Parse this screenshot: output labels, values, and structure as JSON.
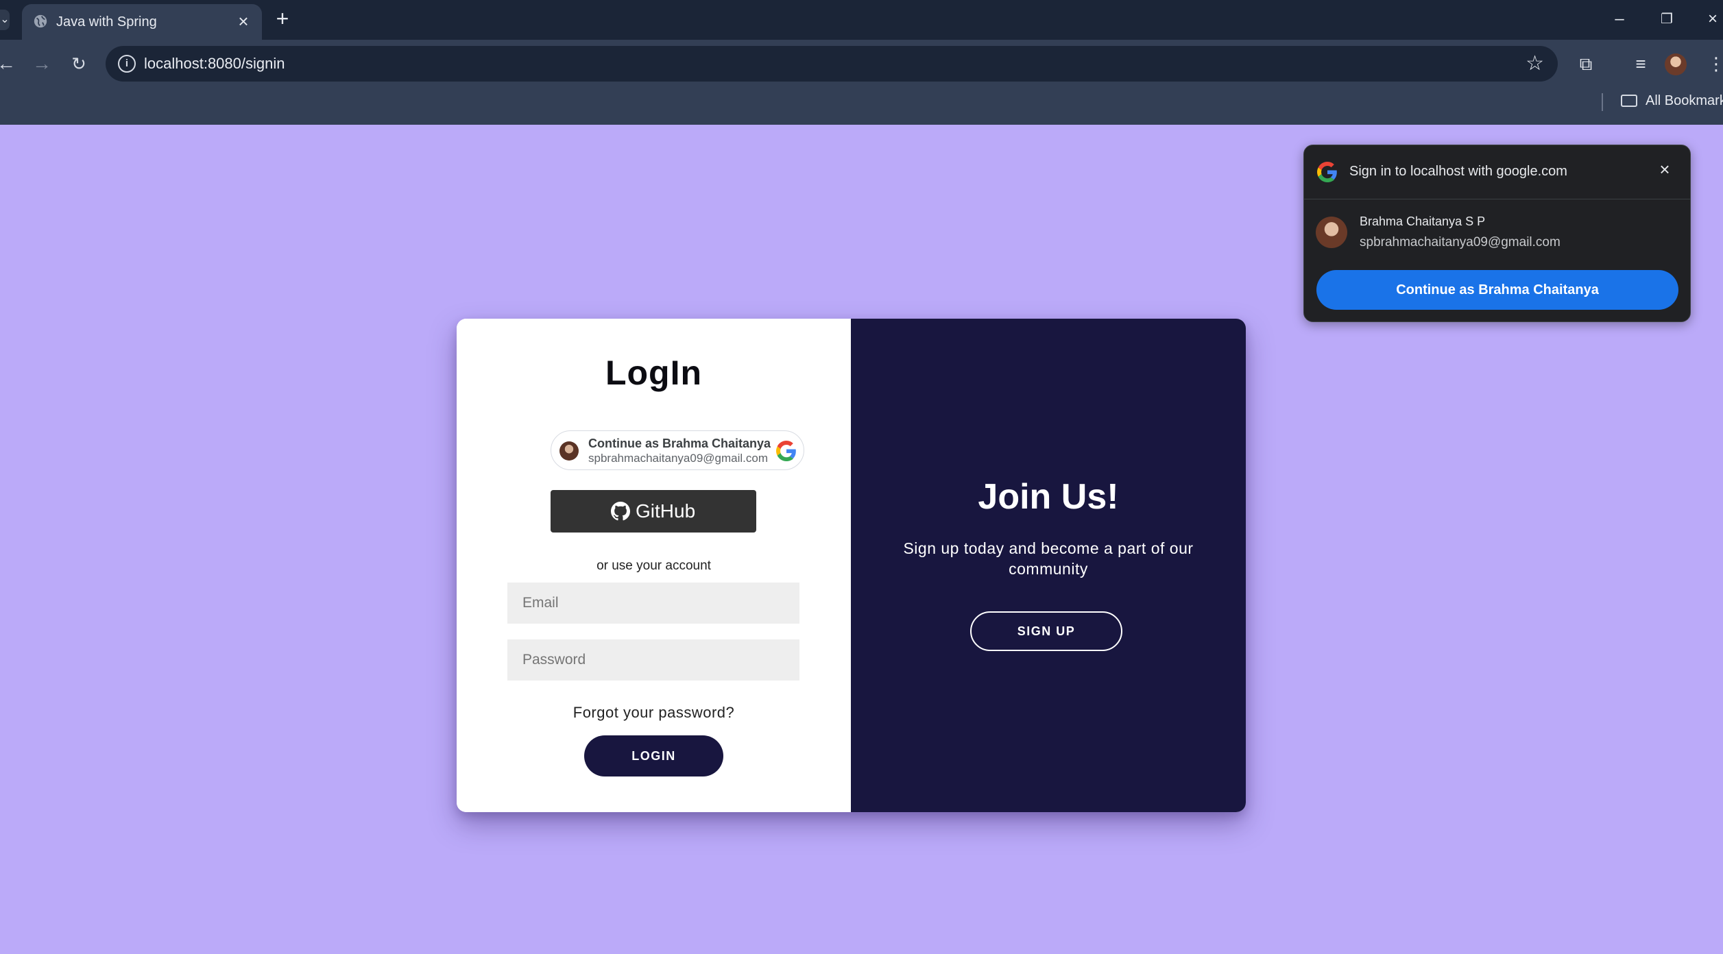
{
  "browser": {
    "tab_title": "Java with Spring",
    "url": "localhost:8080/signin",
    "bookmarks_label": "All Bookmarks",
    "new_tab_symbol": "+",
    "close_symbol": "×"
  },
  "login": {
    "title": "LogIn",
    "google_chip_name": "Continue as Brahma Chaitanya",
    "google_chip_email": "spbrahmachaitanya09@gmail.com",
    "github_label": "GitHub",
    "alt_text": "or use your account",
    "email_placeholder": "Email",
    "password_placeholder": "Password",
    "forgot_label": "Forgot your password?",
    "login_button": "LOGIN"
  },
  "signup_panel": {
    "title": "Join Us!",
    "text": "Sign up today and become a part of our community",
    "button": "SIGN UP"
  },
  "onetap": {
    "title": "Sign in to localhost with google.com",
    "account_name": "Brahma Chaitanya S P",
    "account_email": "spbrahmachaitanya09@gmail.com",
    "continue_label": "Continue as Brahma Chaitanya"
  },
  "colors": {
    "page_background": "#bbaaf9",
    "panel_dark": "#18163f",
    "google_blue": "#1a73e8"
  },
  "icons": [
    "globe-icon",
    "close-icon",
    "back-icon",
    "forward-icon",
    "reload-icon",
    "info-icon",
    "star-icon",
    "extensions-icon",
    "reading-list-icon",
    "avatar",
    "menu-icon",
    "folder-icon",
    "google-icon",
    "github-icon"
  ]
}
